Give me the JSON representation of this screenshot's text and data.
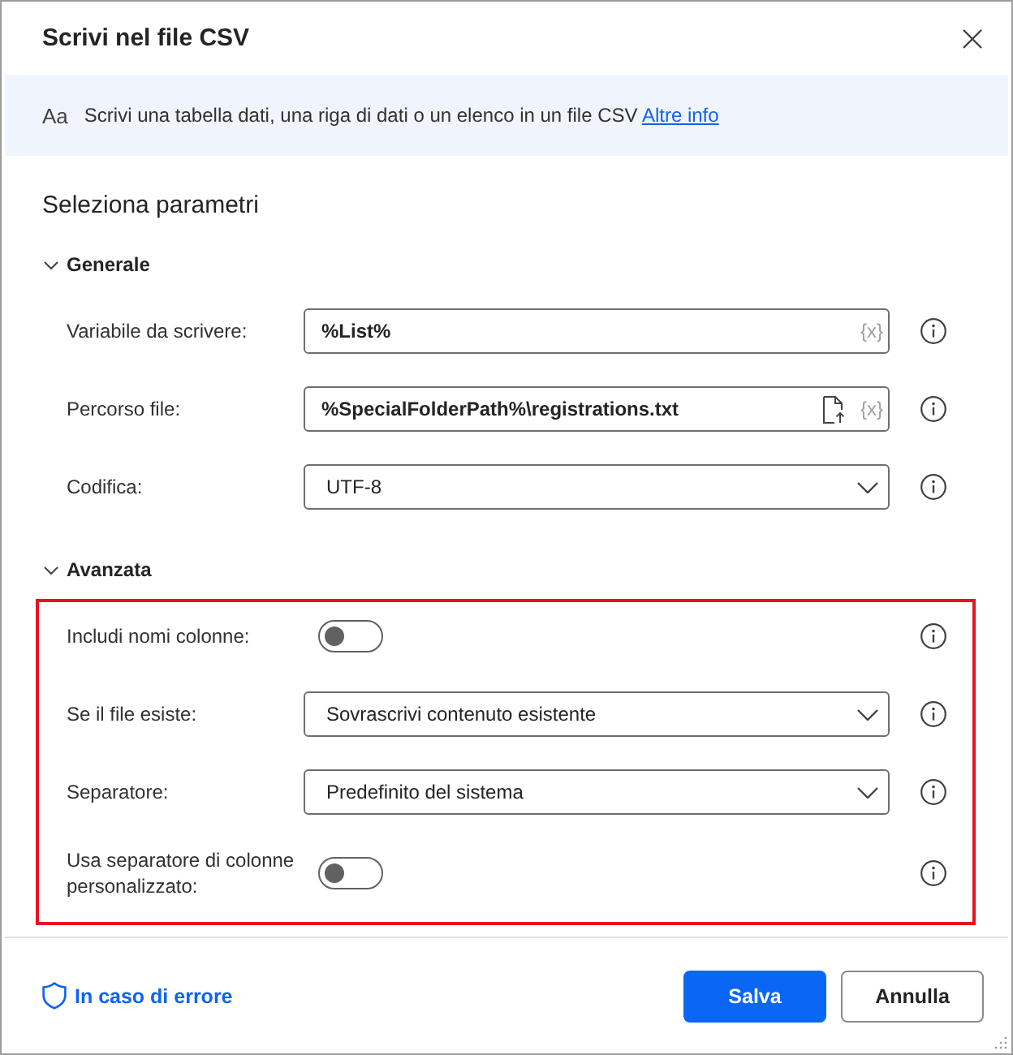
{
  "window": {
    "title": "Scrivi nel file CSV"
  },
  "info_banner": {
    "icon_text": "Aa",
    "text": "Scrivi una tabella dati, una riga di dati o un elenco in un file CSV",
    "link": "Altre info"
  },
  "heading": "Seleziona parametri",
  "sections": [
    {
      "title": "Generale",
      "expanded": true,
      "fields": [
        {
          "kind": "text",
          "label": "Variabile da scrivere:",
          "value": "%List%",
          "variable_button": "{x}"
        },
        {
          "kind": "text",
          "label": "Percorso file:",
          "value": "%SpecialFolderPath%\\registrations.txt",
          "file_picker": true,
          "variable_button": "{x}"
        },
        {
          "kind": "dropdown",
          "label": "Codifica:",
          "value": "UTF-8"
        }
      ]
    },
    {
      "title": "Avanzata",
      "expanded": true,
      "highlighted": true,
      "fields": [
        {
          "kind": "toggle",
          "label": "Includi nomi colonne:",
          "on": false
        },
        {
          "kind": "dropdown",
          "label": "Se il file esiste:",
          "value": "Sovrascrivi contenuto esistente"
        },
        {
          "kind": "dropdown",
          "label": "Separatore:",
          "value": "Predefinito del sistema"
        },
        {
          "kind": "toggle",
          "label": "Usa separatore di colonne personalizzato:",
          "on": false
        }
      ]
    }
  ],
  "footer": {
    "error_link": "In caso di errore",
    "buttons": [
      {
        "label": "Salva",
        "primary": true
      },
      {
        "label": "Annulla",
        "primary": false
      }
    ]
  }
}
